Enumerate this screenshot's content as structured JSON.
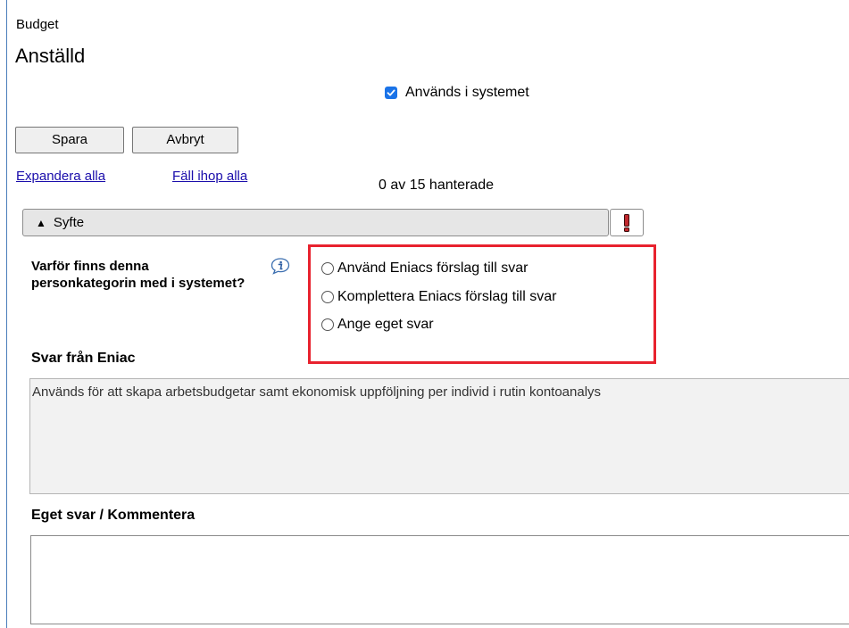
{
  "breadcrumb": "Budget",
  "title": "Anställd",
  "used_checkbox": {
    "label": "Används i systemet",
    "checked": true,
    "color": "#1a73e8"
  },
  "actions": {
    "save_label": "Spara",
    "cancel_label": "Avbryt"
  },
  "links": {
    "expand_all": "Expandera alla",
    "collapse_all": "Fäll ihop alla"
  },
  "status_counter": "0 av 15 hanterade",
  "section": {
    "title": "Syfte",
    "expand_icon": "triangle-up-icon",
    "warning_icon": "exclamation-icon",
    "question": "Varför finns denna personkategorin med i systemet?",
    "info_icon": "info-bubble-icon",
    "options": [
      {
        "label": "Använd Eniacs förslag till svar",
        "selected": false
      },
      {
        "label": "Komplettera Eniacs förslag till svar",
        "selected": false
      },
      {
        "label": "Ange eget svar",
        "selected": false
      }
    ],
    "highlight_color": "#e8222e",
    "eniac_answer_heading": "Svar från Eniac",
    "eniac_answer_text": "Används för att skapa arbetsbudgetar samt ekonomisk uppföljning per individ i rutin kontoanalys",
    "own_answer_heading": "Eget svar / Kommentera",
    "own_answer_value": ""
  }
}
